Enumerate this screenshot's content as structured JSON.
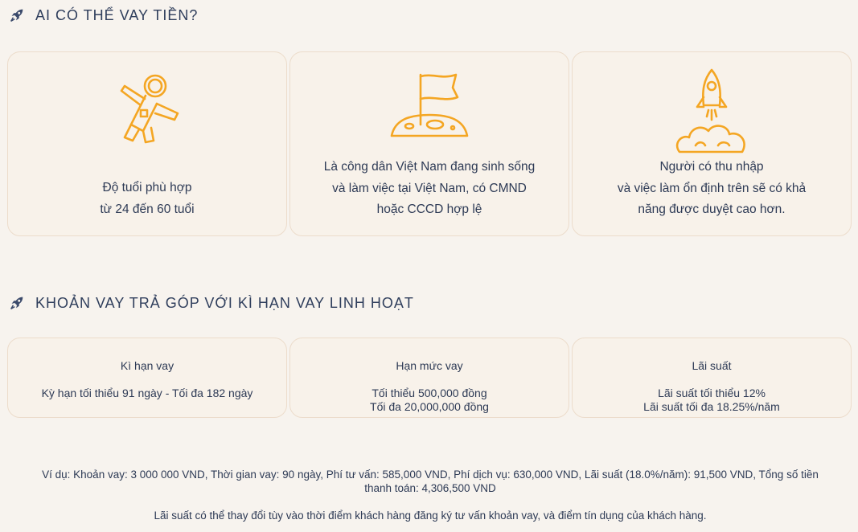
{
  "section1": {
    "title": "AI CÓ THỂ VAY TIỀN?"
  },
  "eligibility": [
    {
      "icon": "astronaut-icon",
      "lines": [
        "Độ tuổi phù hợp",
        "từ 24 đến 60 tuổi"
      ]
    },
    {
      "icon": "moon-flag-icon",
      "lines": [
        "Là công dân Việt Nam đang sinh sống",
        "và làm việc tại Việt Nam, có CMND",
        "hoặc CCCD hợp lệ"
      ]
    },
    {
      "icon": "rocket-launch-icon",
      "lines": [
        "Người có thu nhập",
        "và việc làm ổn định trên sẽ có khả",
        "năng được duyệt cao hơn."
      ]
    }
  ],
  "section2": {
    "title": "KHOẢN VAY TRẢ GÓP VỚI KÌ HẠN VAY LINH HOẠT"
  },
  "loan_terms": [
    {
      "title": "Kì hạn vay",
      "lines": [
        "Kỳ hạn tối thiểu 91 ngày - Tối đa 182 ngày"
      ]
    },
    {
      "title": "Hạn mức vay",
      "lines": [
        "Tối thiểu 500,000 đồng",
        "Tối đa 20,000,000 đồng"
      ]
    },
    {
      "title": "Lãi suất",
      "lines": [
        "Lãi suất tối thiểu 12%",
        "Lãi suất tối đa 18.25%/năm"
      ]
    }
  ],
  "example": {
    "line1": "Ví dụ: Khoản vay: 3 000 000 VND, Thời gian vay: 90 ngày, Phí tư vấn: 585,000 VND, Phí dịch vụ: 630,000 VND, Lãi suất (18.0%/năm): 91,500 VND, Tổng số tiền",
    "line2": "thanh toán: 4,306,500 VND"
  },
  "disclaimer": "Lãi suất có thể thay đổi tùy vào thời điểm khách hàng đăng ký tư vấn khoản vay, và điểm tín dụng của khách hàng.",
  "colors": {
    "accent": "#f4a623",
    "heading": "#2f3e5c",
    "background": "#f7f3ee"
  }
}
